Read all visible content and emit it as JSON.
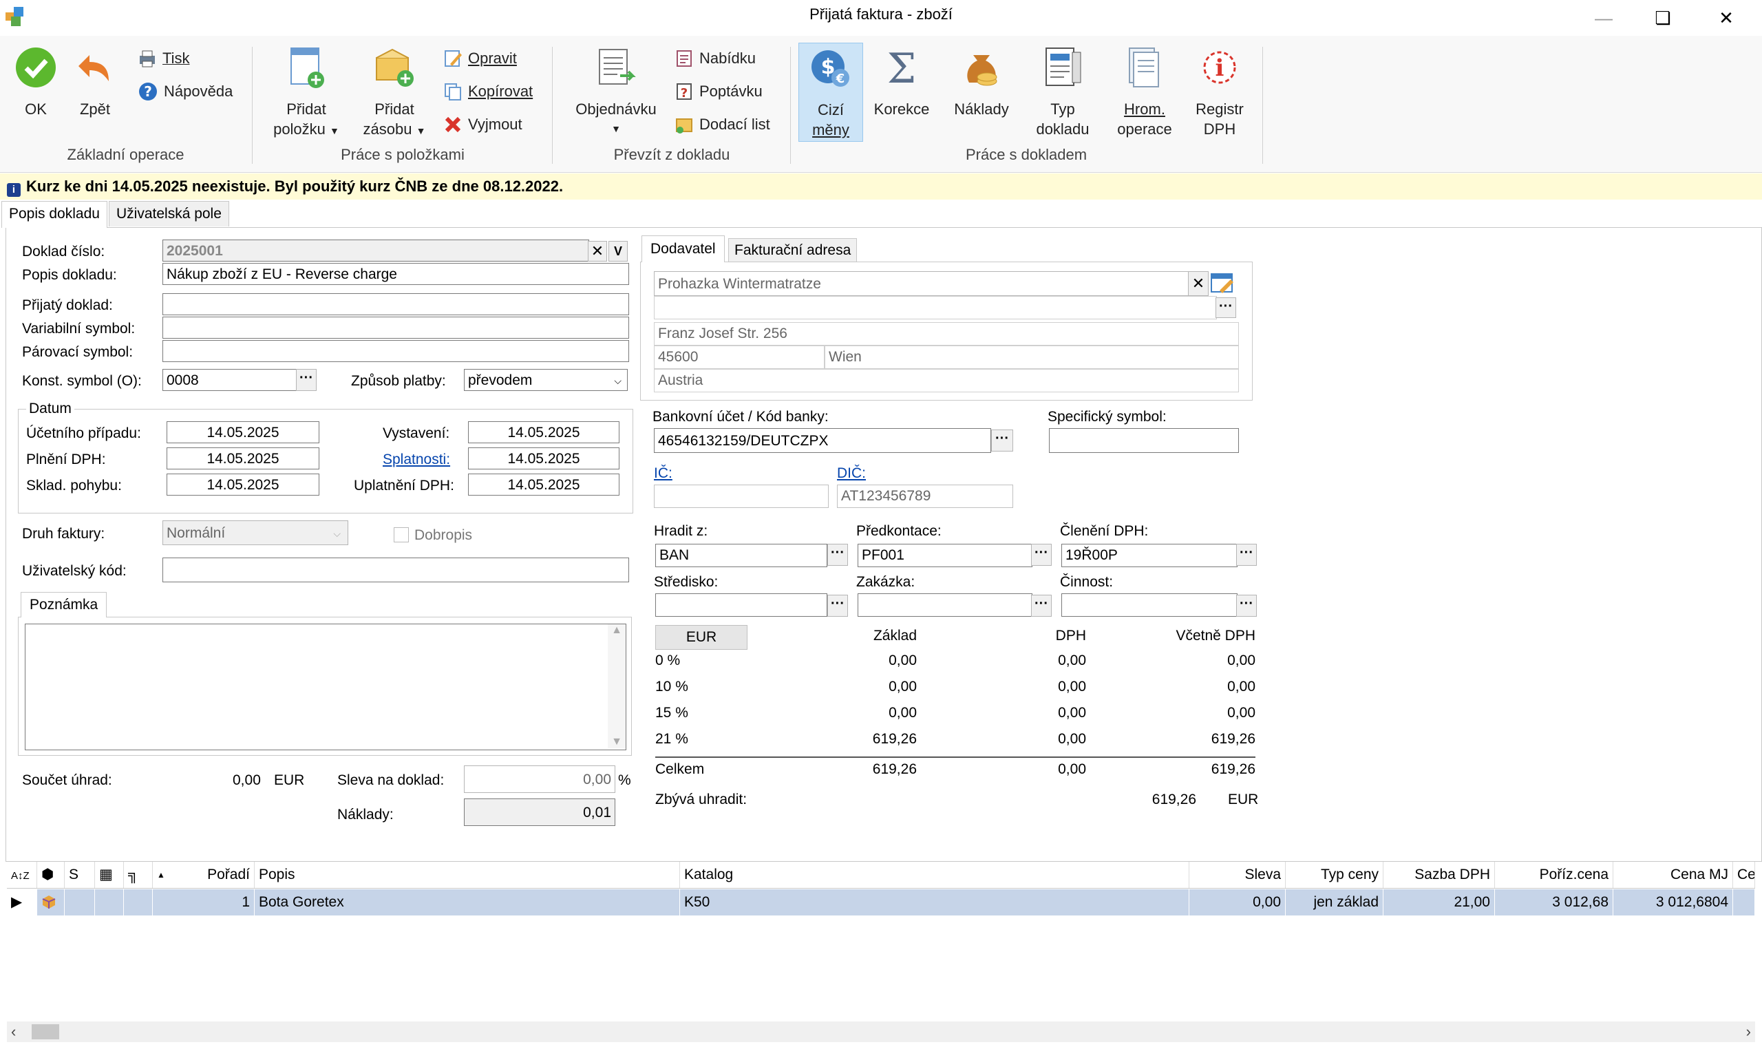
{
  "window": {
    "title": "Přijatá faktura - zboží"
  },
  "ribbon": {
    "groups": {
      "basic": "Základní operace",
      "items": "Práce s položkami",
      "transfer": "Převzít z dokladu",
      "document": "Práce s dokladem"
    },
    "ok": "OK",
    "back": "Zpět",
    "print": "Tisk",
    "help": "Nápověda",
    "add_item_1": "Přidat",
    "add_item_2": "položku",
    "add_stock_1": "Přidat",
    "add_stock_2": "zásobu",
    "edit": "Opravit",
    "copy": "Kopírovat",
    "cut": "Vyjmout",
    "order": "Objednávku",
    "offer": "Nabídku",
    "inquiry": "Poptávku",
    "delivery": "Dodací list",
    "foreign_1": "Cizí",
    "foreign_2": "měny",
    "correction": "Korekce",
    "costs": "Náklady",
    "doctype_1": "Typ",
    "doctype_2": "dokladu",
    "bulk_1": "Hrom.",
    "bulk_2": "operace",
    "vat_1": "Registr",
    "vat_2": "DPH"
  },
  "info": {
    "message": "Kurz ke dni 14.05.2025 neexistuje. Byl použitý kurz ČNB ze dne 08.12.2022."
  },
  "tabs": {
    "description": "Popis dokladu",
    "user_fields": "Uživatelská pole"
  },
  "form": {
    "doc_number_label": "Doklad číslo:",
    "doc_number": "2025001",
    "desc_label": "Popis dokladu:",
    "desc": "Nákup zboží z EU - Reverse charge",
    "received_label": "Přijatý doklad:",
    "variable_label": "Variabilní symbol:",
    "pairing_label": "Párovací symbol:",
    "const_label": "Konst. symbol (O):",
    "const": "0008",
    "payment_label": "Způsob platby:",
    "payment": "převodem",
    "date_group": "Datum",
    "accounting_label": "Účetního případu:",
    "accounting": "14.05.2025",
    "vat_fulfil_label": "Plnění DPH:",
    "vat_fulfil": "14.05.2025",
    "stock_label": "Sklad. pohybu:",
    "stock": "14.05.2025",
    "issued_label": "Vystavení:",
    "issued": "14.05.2025",
    "due_label": "Splatnosti:",
    "due": "14.05.2025",
    "vat_apply_label": "Uplatnění DPH:",
    "vat_apply": "14.05.2025",
    "invoice_type_label": "Druh faktury:",
    "invoice_type": "Normální",
    "credit_note": "Dobropis",
    "user_code_label": "Uživatelský kód:",
    "note_tab": "Poznámka",
    "payments_label": "Součet úhrad:",
    "payments_value": "0,00",
    "payments_currency": "EUR",
    "discount_label": "Sleva na doklad:",
    "discount": "0,00",
    "percent": "%",
    "costs_label": "Náklady:",
    "costs": "0,01"
  },
  "supplier": {
    "tab_supplier": "Dodavatel",
    "tab_billing": "Fakturační adresa",
    "name": "Prohazka Wintermatratze",
    "street": "Franz Josef Str. 256",
    "zip": "45600",
    "city": "Wien",
    "country": "Austria",
    "bank_label": "Bankovní účet / Kód banky:",
    "bank": "46546132159/DEUTCZPX",
    "specific_label": "Specifický symbol:",
    "ic_label": "IČ:",
    "dic_label": "DIČ:",
    "dic": "AT123456789",
    "pay_from_label": "Hradit z:",
    "pay_from": "BAN",
    "precontact_label": "Předkontace:",
    "precontact": "PF001",
    "vat_class_label": "Členění DPH:",
    "vat_class": "19Ř00P",
    "center_label": "Středisko:",
    "contract_label": "Zakázka:",
    "activity_label": "Činnost:"
  },
  "summary": {
    "currency": "EUR",
    "headers": [
      "Základ",
      "DPH",
      "Včetně DPH"
    ],
    "rows": [
      {
        "rate": "0 %",
        "base": "0,00",
        "vat": "0,00",
        "total": "0,00"
      },
      {
        "rate": "10 %",
        "base": "0,00",
        "vat": "0,00",
        "total": "0,00"
      },
      {
        "rate": "15 %",
        "base": "0,00",
        "vat": "0,00",
        "total": "0,00"
      },
      {
        "rate": "21 %",
        "base": "619,26",
        "vat": "0,00",
        "total": "619,26"
      }
    ],
    "total_label": "Celkem",
    "total_base": "619,26",
    "total_vat": "0,00",
    "total_total": "619,26",
    "remaining_label": "Zbývá uhradit:",
    "remaining": "619,26",
    "remaining_currency": "EUR"
  },
  "grid": {
    "headers": {
      "s": "S",
      "order": "Pořadí",
      "desc": "Popis",
      "catalog": "Katalog",
      "discount": "Sleva",
      "price_type": "Typ ceny",
      "vat_rate": "Sazba DPH",
      "purchase": "Poříz.cena",
      "unit_price": "Cena MJ",
      "cen": "Cen"
    },
    "row": {
      "order": "1",
      "desc": "Bota Goretex",
      "catalog": "K50",
      "discount": "0,00",
      "price_type": "jen základ",
      "vat_rate": "21,00",
      "purchase": "3 012,68",
      "unit_price": "3 012,6804"
    }
  }
}
